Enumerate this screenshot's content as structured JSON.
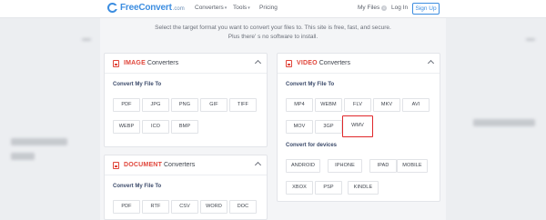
{
  "header": {
    "logo_text": "FreeConvert",
    "logo_tld": ".com",
    "nav_converters": "Converters",
    "nav_tools": "Tools",
    "nav_pricing": "Pricing",
    "my_files": "My Files",
    "my_files_count": "0",
    "login": "Log In",
    "signup": "Sign Up",
    "brand_color": "#3c8de0"
  },
  "tagline": {
    "line1": "Select the target format you want to convert your files to. This site is free, fast, and secure.",
    "line2": "Plus there' s no software to install."
  },
  "image_card": {
    "title_highlight": "IMAGE",
    "title_rest": "Converters",
    "section1": "Convert My File To",
    "formats": [
      "PDF",
      "JPG",
      "PNG",
      "GIF",
      "TIFF",
      "WEBP",
      "ICO",
      "BMP"
    ]
  },
  "document_card": {
    "title_highlight": "DOCUMENT",
    "title_rest": "Converters",
    "section1": "Convert My File To",
    "formats": [
      "PDF",
      "RTF",
      "CSV",
      "WORD",
      "DOC"
    ]
  },
  "video_card": {
    "title_highlight": "VIDEO",
    "title_rest": "Converters",
    "section1": "Convert My File To",
    "formats": [
      "MP4",
      "WEBM",
      "FLV",
      "MKV",
      "AVI",
      "MOV",
      "3GP",
      "WMV"
    ],
    "selected_format": "WMV",
    "section2": "Convert for devices",
    "devices": [
      "ANDROID",
      "IPHONE",
      "IPAD",
      "MOBILE",
      "XBOX",
      "PSP",
      "KINDLE"
    ]
  },
  "highlight_color": "#e0453a"
}
